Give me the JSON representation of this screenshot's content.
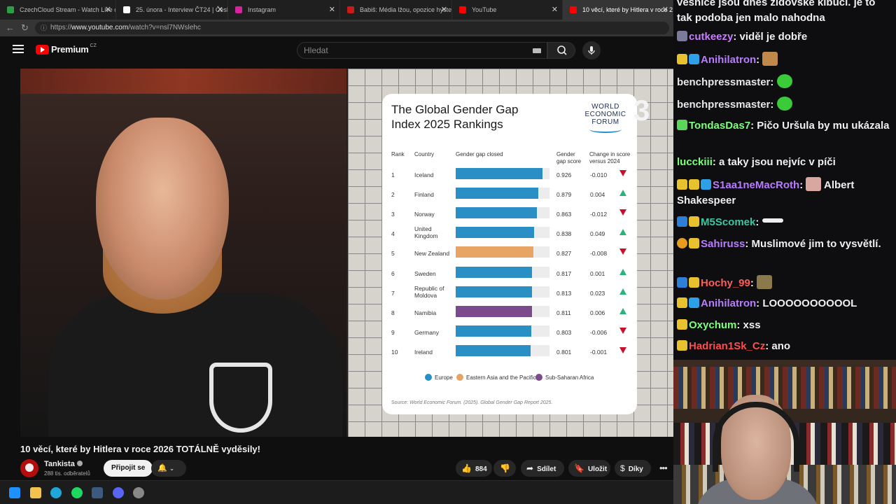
{
  "browser": {
    "tabs": [
      {
        "title": "CzechCloud Stream - Watch Live o",
        "favicon_color": "#2e9e44"
      },
      {
        "title": "25. února - Interview ČT24 | Česká",
        "favicon_color": "#ffffff"
      },
      {
        "title": "Instagram",
        "favicon_color": "#d6249f"
      },
      {
        "title": "Babiš: Média lžou, opozice hyster",
        "favicon_color": "#cc1a1a"
      },
      {
        "title": "YouTube",
        "favicon_color": "#ff0000"
      },
      {
        "title": "10 věcí, které by Hitlera v roce 202",
        "favicon_color": "#ff0000"
      }
    ],
    "url_prefix": "https://",
    "url_host": "www.youtube.com",
    "url_path": "/watch?v=nsl7NWslehc"
  },
  "youtube": {
    "logo_text": "Premium",
    "region": "CZ",
    "search_placeholder": "Hledat",
    "video_title": "10 věcí, které by Hitlera v roce 2026 TOTÁLNĚ vyděsily!",
    "channel_name": "Tankista",
    "subscribers": "288 tis. odběratelů",
    "join_label": "Připojit se",
    "like_count": "884",
    "share_label": "Sdílet",
    "save_label": "Uložit",
    "thanks_label": "Díky"
  },
  "chart_card": {
    "title_line1": "The Global Gender Gap",
    "title_line2": "Index 2025 Rankings",
    "wef_line1": "WORLD",
    "wef_line2": "ECONOMIC",
    "wef_line3": "FORUM",
    "slide_number": "3",
    "source_label": "Source:",
    "source_text": "World Economic Forum. (2025). Global Gender Gap Report 2025."
  },
  "chart_data": {
    "type": "bar",
    "title": "The Global Gender Gap Index 2025 Rankings",
    "columns": [
      "Rank",
      "Country",
      "Gender gap closed",
      "Gender gap score",
      "Change in score versus 2024"
    ],
    "xlim": [
      0,
      1
    ],
    "rows": [
      {
        "rank": "1",
        "country": "Iceland",
        "score": 0.926,
        "score_label": "0.926",
        "change": "-0.010",
        "direction": "down",
        "region": "Europe"
      },
      {
        "rank": "2",
        "country": "Finland",
        "score": 0.879,
        "score_label": "0.879",
        "change": "0.004",
        "direction": "up",
        "region": "Europe"
      },
      {
        "rank": "3",
        "country": "Norway",
        "score": 0.863,
        "score_label": "0.863",
        "change": "-0.012",
        "direction": "down",
        "region": "Europe"
      },
      {
        "rank": "4",
        "country": "United Kingdom",
        "score": 0.838,
        "score_label": "0.838",
        "change": "0.049",
        "direction": "up",
        "region": "Europe"
      },
      {
        "rank": "5",
        "country": "New Zealand",
        "score": 0.827,
        "score_label": "0.827",
        "change": "-0.008",
        "direction": "down",
        "region": "Eastern Asia and the Pacific"
      },
      {
        "rank": "6",
        "country": "Sweden",
        "score": 0.817,
        "score_label": "0.817",
        "change": "0.001",
        "direction": "up",
        "region": "Europe"
      },
      {
        "rank": "7",
        "country": "Republic of Moldova",
        "score": 0.813,
        "score_label": "0.813",
        "change": "0.023",
        "direction": "up",
        "region": "Europe"
      },
      {
        "rank": "8",
        "country": "Namibia",
        "score": 0.811,
        "score_label": "0.811",
        "change": "0.006",
        "direction": "up",
        "region": "Sub-Saharan Africa"
      },
      {
        "rank": "9",
        "country": "Germany",
        "score": 0.803,
        "score_label": "0.803",
        "change": "-0.006",
        "direction": "down",
        "region": "Europe"
      },
      {
        "rank": "10",
        "country": "Ireland",
        "score": 0.801,
        "score_label": "0.801",
        "change": "-0.001",
        "direction": "down",
        "region": "Europe"
      }
    ],
    "legend": [
      {
        "name": "Europe",
        "color": "#2a8fc4"
      },
      {
        "name": "Eastern Asia and the Pacific",
        "color": "#e8a464"
      },
      {
        "name": "Sub-Saharan Africa",
        "color": "#7a4a8c"
      }
    ]
  },
  "chat": {
    "top_text": "vesnice jsou dnes židovské kibucí. je to tak podoba jen malo nahodna",
    "messages": [
      {
        "user": "cutkeezy",
        "color": "#c77dff",
        "text": "viděl je dobře"
      },
      {
        "user": "Anihilatron",
        "color": "#b87cff",
        "text": ""
      },
      {
        "user": "benchpressmaster",
        "color": "#e6e6e6",
        "text": ""
      },
      {
        "user": "benchpressmaster",
        "color": "#e6e6e6",
        "text": ""
      },
      {
        "user": "TondasDas7",
        "color": "#7cff7c",
        "text": "Pičo Uršula by mu ukázala"
      },
      {
        "user": "lucckiii",
        "color": "#7cff7c",
        "text": "a taky jsou nejvíc v píči"
      },
      {
        "user": "S1aa1neMacRoth",
        "color": "#b87cff",
        "text": "Albert Shakespeer"
      },
      {
        "user": "M5Scomek",
        "color": "#3cc7a0",
        "text": ""
      },
      {
        "user": "Sahiruss",
        "color": "#b87cff",
        "text": "Muslimové jim to vysvětlí."
      },
      {
        "user": "Hochy_99",
        "color": "#ff5c5c",
        "text": ""
      },
      {
        "user": "Anihilatron",
        "color": "#b87cff",
        "text": "LOOOOOOOOOOL"
      },
      {
        "user": "Oxychum",
        "color": "#7cff7c",
        "text": "xss"
      },
      {
        "user": "Hadrian1Sk_Cz",
        "color": "#ff4d4d",
        "text": "ano"
      }
    ]
  }
}
